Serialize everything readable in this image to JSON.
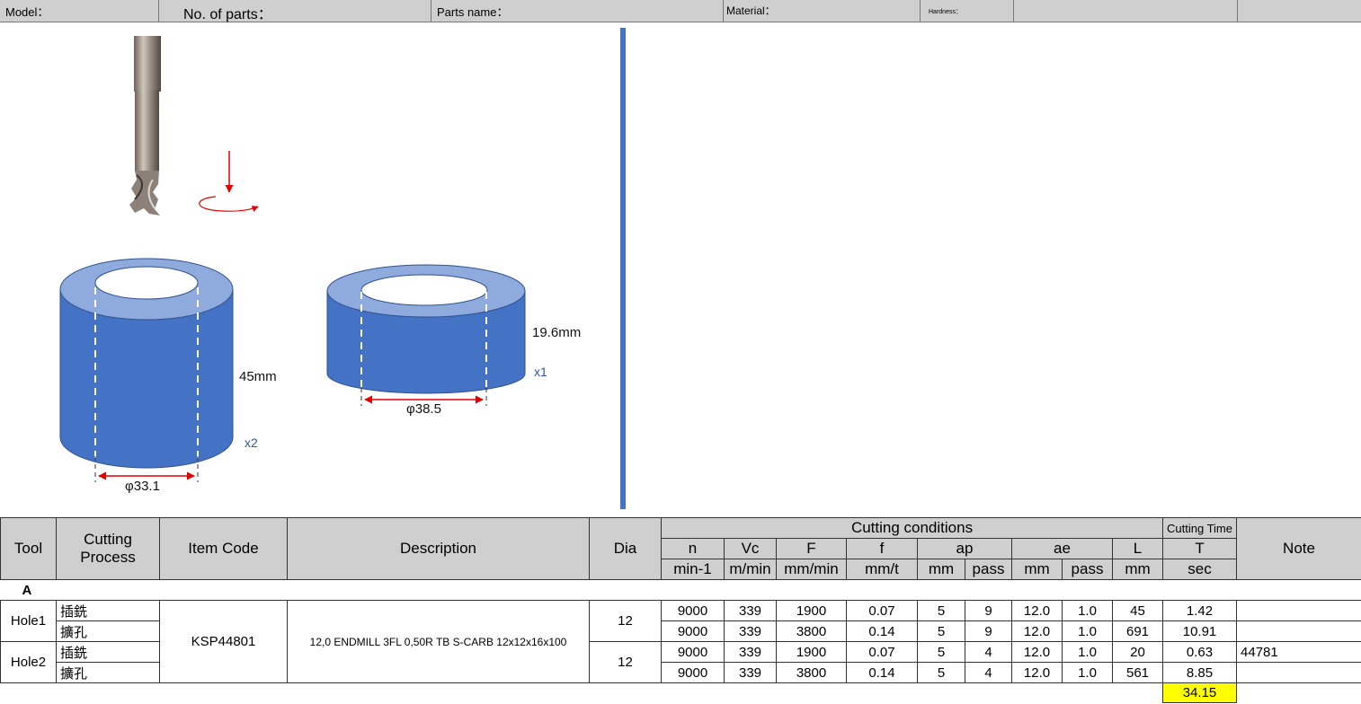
{
  "header": {
    "model_label": "Model：",
    "parts_count_label": "No. of parts：",
    "parts_name_label": "Parts name：",
    "material_label": "Material：",
    "hardness_label": "Hardness："
  },
  "drawing": {
    "cylinder1": {
      "height": "45mm",
      "diameter": "φ33.1",
      "qty": "x2"
    },
    "cylinder2": {
      "height": "19.6mm",
      "diameter": "φ38.5",
      "qty": "x1"
    },
    "icons": [
      "endmill-tool-icon",
      "rotation-arrow-icon"
    ]
  },
  "table": {
    "headers": {
      "tool": "Tool",
      "process_line1": "Cutting",
      "process_line2": "Process",
      "item_code": "Item Code",
      "description": "Description",
      "dia": "Dia",
      "cutting_conditions": "Cutting conditions",
      "cutting_time": "Cutting Time",
      "note": "Note",
      "n": "n",
      "vc": "Vc",
      "F": "F",
      "f": "f",
      "ap": "ap",
      "ae": "ae",
      "L": "L",
      "T": "T",
      "unit_n": "min-1",
      "unit_vc": "m/min",
      "unit_F": "mm/min",
      "unit_f": "mm/t",
      "unit_ap": "mm",
      "unit_ap_pass": "pass",
      "unit_ae": "mm",
      "unit_ae_pass": "pass",
      "unit_L": "mm",
      "unit_T": "sec"
    },
    "group": "A",
    "item_code": "KSP44801",
    "description": "12,0 ENDMILL 3FL 0,50R TB S-CARB 12x12x16x100",
    "holes": [
      {
        "name": "Hole1",
        "dia": "12",
        "rows": [
          {
            "process": "插銑",
            "n": "9000",
            "vc": "339",
            "F": "1900",
            "f": "0.07",
            "ap": "5",
            "ap_pass": "9",
            "ae": "12.0",
            "ae_pass": "1.0",
            "L": "45",
            "T": "1.42",
            "note": ""
          },
          {
            "process": "擴孔",
            "n": "9000",
            "vc": "339",
            "F": "3800",
            "f": "0.14",
            "ap": "5",
            "ap_pass": "9",
            "ae": "12.0",
            "ae_pass": "1.0",
            "L": "691",
            "T": "10.91",
            "note": ""
          }
        ]
      },
      {
        "name": "Hole2",
        "dia": "12",
        "rows": [
          {
            "process": "插銑",
            "n": "9000",
            "vc": "339",
            "F": "1900",
            "f": "0.07",
            "ap": "5",
            "ap_pass": "4",
            "ae": "12.0",
            "ae_pass": "1.0",
            "L": "20",
            "T": "0.63",
            "note": "44781"
          },
          {
            "process": "擴孔",
            "n": "9000",
            "vc": "339",
            "F": "3800",
            "f": "0.14",
            "ap": "5",
            "ap_pass": "4",
            "ae": "12.0",
            "ae_pass": "1.0",
            "L": "561",
            "T": "8.85",
            "note": ""
          }
        ]
      }
    ],
    "total_time": "34.15"
  },
  "colors": {
    "cylinder_side": "#4472c4",
    "cylinder_top": "#8faadc",
    "divider": "#4472c4",
    "dimension_arrow": "#e00000",
    "header_bg": "#cfcfcf",
    "total_highlight": "#ffff00"
  }
}
